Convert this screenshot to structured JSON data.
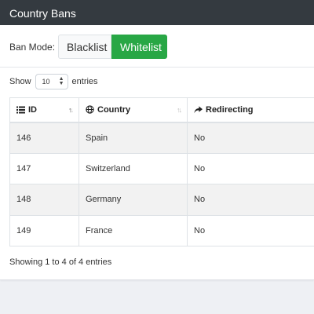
{
  "header": {
    "title": "Country Bans"
  },
  "ban_mode": {
    "label": "Ban Mode:",
    "options": [
      {
        "label": "Blacklist",
        "active": false
      },
      {
        "label": "Whitelist",
        "active": true
      }
    ]
  },
  "length": {
    "prefix": "Show",
    "value": "10",
    "suffix": "entries"
  },
  "table": {
    "columns": [
      {
        "label": "ID",
        "icon": "list-icon",
        "sort": "ascending"
      },
      {
        "label": "Country",
        "icon": "globe-icon",
        "sort": "none"
      },
      {
        "label": "Redirecting",
        "icon": "share-arrow-icon",
        "sort": "none"
      }
    ],
    "rows": [
      {
        "id": "146",
        "country": "Spain",
        "redirecting": "No"
      },
      {
        "id": "147",
        "country": "Switzerland",
        "redirecting": "No"
      },
      {
        "id": "148",
        "country": "Germany",
        "redirecting": "No"
      },
      {
        "id": "149",
        "country": "France",
        "redirecting": "No"
      }
    ]
  },
  "info": "Showing 1 to 4 of 4 entries",
  "colors": {
    "header_bg": "#343a40",
    "active_button": "#28a745",
    "stripe": "#f2f2f2"
  }
}
